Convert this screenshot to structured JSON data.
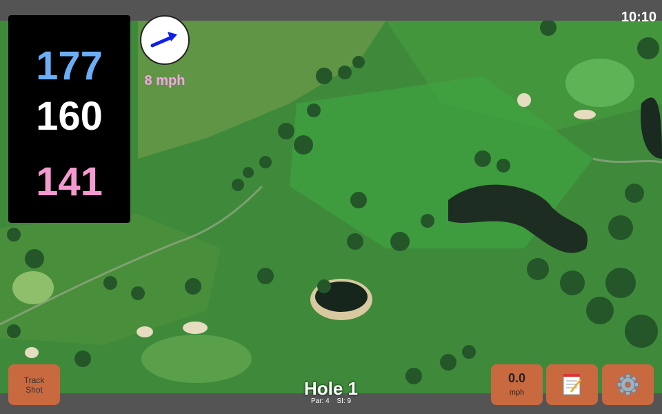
{
  "status": {
    "time": "10:10"
  },
  "yardages": {
    "back": "177",
    "middle": "160",
    "front": "141"
  },
  "wind": {
    "speed": "8 mph",
    "direction_icon": "wind-arrow-icon"
  },
  "hole": {
    "title": "Hole 1",
    "par": "Par: 4",
    "si": "SI: 9"
  },
  "buttons": {
    "track_line1": "Track",
    "track_line2": "Shot",
    "speed_value": "0.0",
    "speed_unit": "mph",
    "notes_icon": "notepad-icon",
    "settings_icon": "gear-icon"
  },
  "colors": {
    "back_yardage": "#6aaef5",
    "middle_yardage": "#ffffff",
    "front_yardage": "#f49ad0",
    "button_bg": "#c9693f",
    "wind_text": "#f5a6e6"
  }
}
